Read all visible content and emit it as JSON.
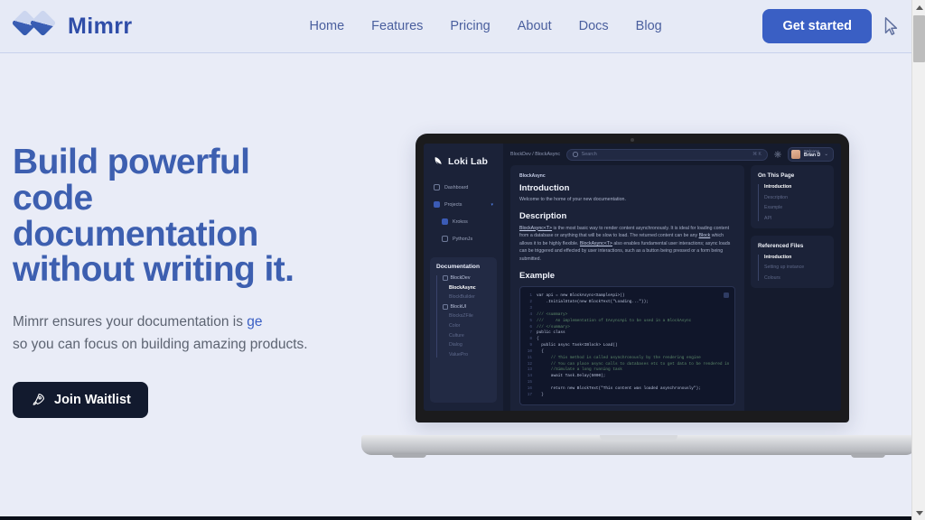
{
  "site": {
    "brand": "Mimrr",
    "nav": [
      "Home",
      "Features",
      "Pricing",
      "About",
      "Docs",
      "Blog"
    ],
    "cta": "Get started"
  },
  "hero": {
    "headline_lines": [
      "Build powerful",
      "code",
      "documentation",
      "without writing it."
    ],
    "subtitle_prefix": "Mimrr ensures your documentation is ",
    "subtitle_highlight": "ge",
    "subtitle_line2": "so you can focus on building amazing products.",
    "waitlist_label": "Join Waitlist"
  },
  "app": {
    "name": "Loki Lab",
    "sidebar": [
      {
        "label": "Dashboard",
        "icon": "dashboard-icon",
        "level": 0,
        "fill": false
      },
      {
        "label": "Projects",
        "icon": "folder-icon",
        "level": 0,
        "fill": true,
        "caret": "▾"
      },
      {
        "label": "Krokos",
        "icon": "cube-icon",
        "level": 1,
        "fill": true
      },
      {
        "label": "PythonJs",
        "icon": "cube-icon",
        "level": 1,
        "fill": false
      }
    ],
    "doc_panel": {
      "title": "Documentation",
      "items": [
        {
          "label": "BlockDev",
          "level": 1,
          "active": false
        },
        {
          "label": "BlockAsync",
          "level": 2,
          "active": true
        },
        {
          "label": "BlockBuilder",
          "level": 2,
          "active": false
        },
        {
          "label": "BlockUI",
          "level": 1,
          "active": false
        },
        {
          "label": "BlocksZFile",
          "level": 2,
          "active": false
        },
        {
          "label": "Color",
          "level": 2,
          "active": false
        },
        {
          "label": "Culture",
          "level": 2,
          "active": false
        },
        {
          "label": "Dialog",
          "level": 2,
          "active": false
        },
        {
          "label": "ValuePro",
          "level": 2,
          "active": false
        }
      ]
    },
    "topbar": {
      "breadcrumb": "BlockDev / BlockAsync",
      "search_placeholder": "Search",
      "search_shortcut": "⌘ K",
      "user_welcome": "Welcome,",
      "user_name": "Brian D",
      "chevron": "⌄"
    },
    "article": {
      "eyebrow": "BlockAsync",
      "intro_title": "Introduction",
      "intro_text": "Welcome to the home of your new documentation.",
      "desc_title": "Description",
      "desc_link1": "BlockAsync<T>",
      "desc_part1": " is the most basic way to render content asynchronously. It is ideal for loading content from a database or anything that will be slow to load. The returned content can be any ",
      "desc_link2": "Block",
      "desc_part2": " which allows it to be highly flexible. ",
      "desc_link3": "BlockAsync<T>",
      "desc_part3": " also enables fundamental user interactions; async loads can be triggered and effected by user interactions, such as a button being pressed or a form being submitted.",
      "example_title": "Example",
      "code": [
        {
          "n": "1",
          "text": "var api = new BlockAsync<SampleApi>()"
        },
        {
          "n": "2",
          "text": "    .InitialState(new BlockText(\"Loading...\"));"
        },
        {
          "n": "3",
          "text": ""
        },
        {
          "n": "4",
          "text": "/// <summary>"
        },
        {
          "n": "5",
          "text": "///     An implementation of IAsyncApi to be used in a BlockAsync"
        },
        {
          "n": "6",
          "text": "/// </summary>"
        },
        {
          "n": "7",
          "text": "public class"
        },
        {
          "n": "8",
          "text": "{"
        },
        {
          "n": "9",
          "text": "  public async Task<IBlock> Load()"
        },
        {
          "n": "10",
          "text": "  {"
        },
        {
          "n": "11",
          "text": "      // This method is called asynchronously by the rendering engine"
        },
        {
          "n": "12",
          "text": "      // You can place async calls to databases etc to get data to be rendered in"
        },
        {
          "n": "13",
          "text": "      //Simulate a long running task"
        },
        {
          "n": "14",
          "text": "      await Task.Delay(5000);"
        },
        {
          "n": "15",
          "text": ""
        },
        {
          "n": "16",
          "text": "      return new BlockText(\"This content was loaded asynchronously\");"
        },
        {
          "n": "17",
          "text": "  }"
        }
      ]
    },
    "rail": [
      {
        "title": "On This Page",
        "items": [
          {
            "label": "Introduction",
            "active": true
          },
          {
            "label": "Description",
            "active": false
          },
          {
            "label": "Example",
            "active": false
          },
          {
            "label": "API",
            "active": false
          }
        ]
      },
      {
        "title": "Referenced Files",
        "items": [
          {
            "label": "Introduction",
            "active": true
          },
          {
            "label": "Setting up instance",
            "active": false
          },
          {
            "label": "Colours",
            "active": false
          }
        ]
      }
    ]
  },
  "colors": {
    "page_bg": "#e9ecf7",
    "accent_blue": "#3a5fc4",
    "headline_blue": "#3d5fb0",
    "dark_navy": "#121a2e"
  }
}
